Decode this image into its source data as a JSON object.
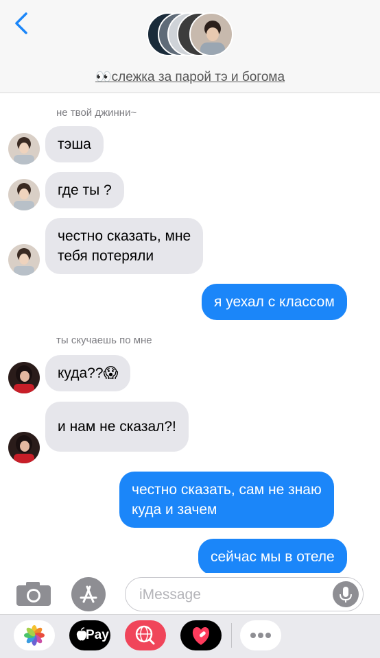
{
  "header": {
    "group_title": "👀слежка за парой тэ и богома"
  },
  "messages": [
    {
      "sender": "не твой джинни~"
    },
    {
      "text": "тэша"
    },
    {
      "text": "где ты ?"
    },
    {
      "text": "честно сказать, мне\nтебя потеряли"
    },
    {
      "text": "я уехал с классом"
    },
    {
      "sender": "ты скучаешь по мне"
    },
    {
      "text": "куда??😱"
    },
    {
      "text": "и нам не сказал?!"
    },
    {
      "text": "честно сказать, сам не знаю\nкуда и зачем"
    },
    {
      "text": "сейчас мы в отеле"
    }
  ],
  "input": {
    "placeholder": "iMessage"
  },
  "drawer": {
    "apple_pay_label": "Pay",
    "apps": [
      "photos-app",
      "apple-pay-app",
      "search-images-app",
      "digital-touch-app",
      "more-apps"
    ]
  },
  "colors": {
    "outgoing_bubble": "#1b86f9",
    "incoming_bubble": "#e6e6eb",
    "accent": "#1b86f9"
  }
}
